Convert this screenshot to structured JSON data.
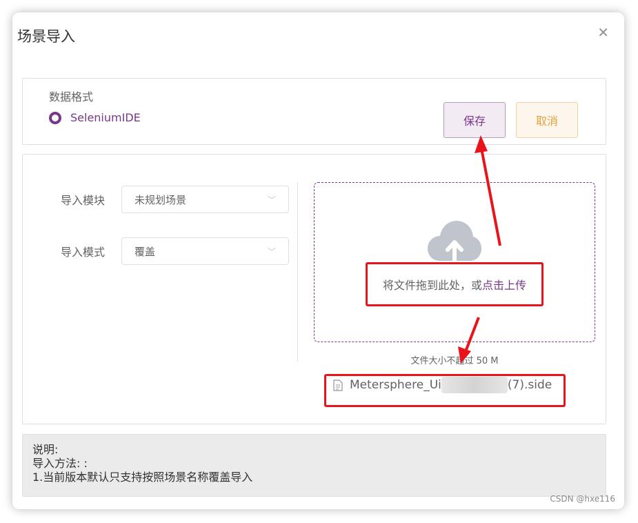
{
  "dialog": {
    "title": "场景导入",
    "close_icon": "close-icon"
  },
  "format": {
    "label": "数据格式",
    "option": "SeleniumIDE",
    "save_label": "保存",
    "cancel_label": "取消"
  },
  "form": {
    "module_label": "导入模块",
    "module_value": "未规划场景",
    "mode_label": "导入模式",
    "mode_value": "覆盖"
  },
  "upload": {
    "text": "将文件拖到此处，或",
    "link": "点击上传",
    "tip": "文件大小不超过 50 M",
    "file_prefix": "Metersphere_Ui",
    "file_suffix": "(7).side"
  },
  "note": {
    "line1": "说明:",
    "line2": "导入方法: :",
    "line3": "1.当前版本默认只支持按照场景名称覆盖导入"
  },
  "watermark": "CSDN @hxe116",
  "colors": {
    "accent": "#783887",
    "warning": "#e6a23c",
    "annotation": "#e8131b"
  }
}
